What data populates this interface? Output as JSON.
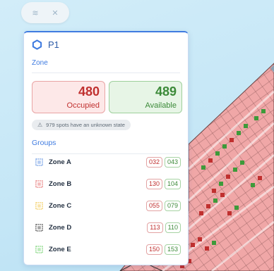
{
  "toolbar": {
    "buttons": [
      {
        "icon": "layers-icon",
        "glyph": "≋"
      },
      {
        "icon": "fullscreen-icon",
        "glyph": "✕"
      }
    ]
  },
  "panel": {
    "title": "P1",
    "zone_label": "Zone",
    "occupied": {
      "value": "480",
      "label": "Occupied"
    },
    "available": {
      "value": "489",
      "label": "Available"
    },
    "unknown_text": "979 spots have an unknown state",
    "groups_label": "Groups",
    "groups": [
      {
        "name": "Zone A",
        "occupied": "032",
        "available": "043",
        "color": "#5b8fe0"
      },
      {
        "name": "Zone B",
        "occupied": "130",
        "available": "104",
        "color": "#e46a6a"
      },
      {
        "name": "Zone C",
        "occupied": "055",
        "available": "079",
        "color": "#f1c64a"
      },
      {
        "name": "Zone D",
        "occupied": "113",
        "available": "110",
        "color": "#3a3a3a"
      },
      {
        "name": "Zone E",
        "occupied": "150",
        "available": "153",
        "color": "#6fd06b"
      }
    ]
  },
  "colors": {
    "accent": "#3f7be0",
    "occupied": "#c0302f",
    "available": "#3c8a39",
    "map_zone": "#f0a7a7"
  }
}
